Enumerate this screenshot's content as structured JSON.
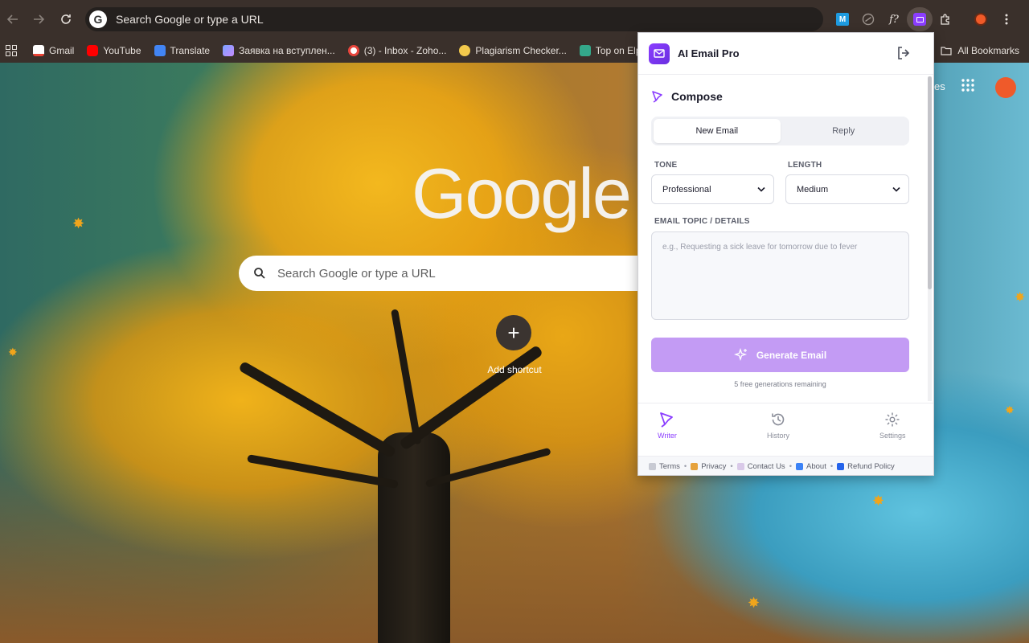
{
  "browser": {
    "omnibox_text": "Search Google or type a URL",
    "bookmarks": [
      {
        "label": "Gmail",
        "color": "#ea4335"
      },
      {
        "label": "YouTube",
        "color": "#ff0000"
      },
      {
        "label": "Translate",
        "color": "#4285f4"
      },
      {
        "label": "Заявка на вступлен...",
        "color": "#7aa2ff"
      },
      {
        "label": "(3) - Inbox - Zoho...",
        "color": "#e8453c"
      },
      {
        "label": "Plagiarism Checker...",
        "color": "#f2c94c"
      },
      {
        "label": "Top on Elpha: wh",
        "color": "#34a88a"
      }
    ],
    "all_bookmarks_label": "All Bookmarks"
  },
  "newtab": {
    "logo_text": "Google",
    "search_placeholder": "Search Google or type a URL",
    "add_shortcut_label": "Add shortcut",
    "partial_text": "es"
  },
  "popup": {
    "app_title": "AI Email Pro",
    "compose_title": "Compose",
    "tabs": [
      {
        "label": "New Email",
        "active": true
      },
      {
        "label": "Reply",
        "active": false
      }
    ],
    "tone_label": "TONE",
    "tone_value": "Professional",
    "length_label": "LENGTH",
    "length_value": "Medium",
    "topic_label": "EMAIL TOPIC / DETAILS",
    "topic_placeholder": "e.g., Requesting a sick leave for tomorrow due to fever",
    "generate_label": "Generate Email",
    "remaining_text": "5 free generations remaining",
    "nav": [
      {
        "label": "Writer",
        "active": true
      },
      {
        "label": "History",
        "active": false
      },
      {
        "label": "Settings",
        "active": false
      }
    ],
    "footer": [
      "Terms",
      "Privacy",
      "Contact Us",
      "About",
      "Refund Policy"
    ],
    "accent": "#8b3dff",
    "button_color": "#c39bf4"
  }
}
